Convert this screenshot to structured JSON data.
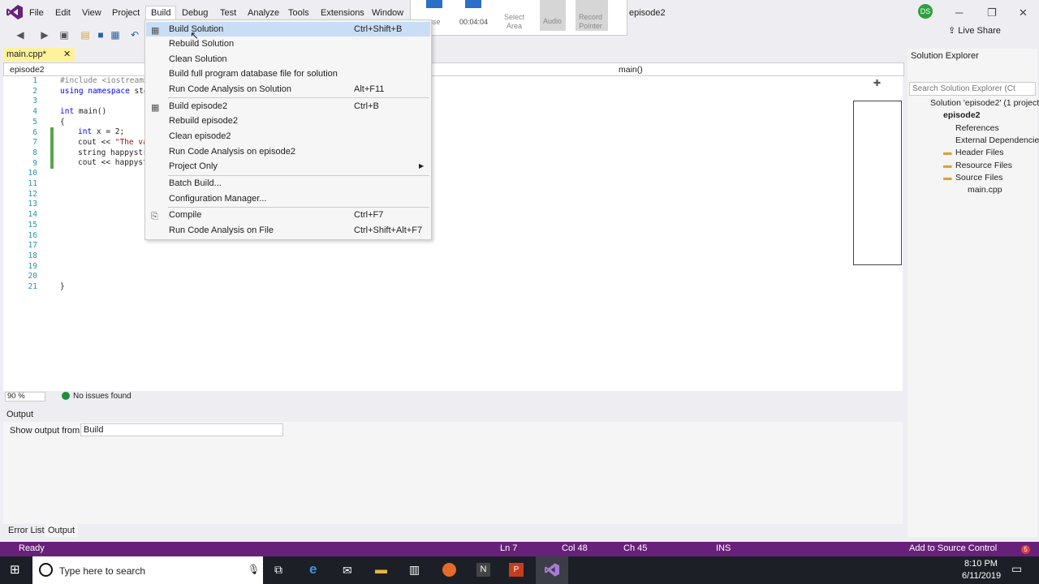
{
  "menu": [
    "File",
    "Edit",
    "View",
    "Project",
    "Build",
    "Debug",
    "Test",
    "Analyze",
    "Tools",
    "Extensions",
    "Window"
  ],
  "window_title": "episode2",
  "user_initials": "DS",
  "live_share": "Live Share",
  "recorder": {
    "timer": "00:04:04",
    "pause": "use",
    "select_area": [
      "Select",
      "Area"
    ],
    "audio": "Audio",
    "record_pointer": [
      "Record",
      "Pointer"
    ]
  },
  "doc_tab": "main.cpp*",
  "nav": {
    "scope": "episode2",
    "member": "main()"
  },
  "code_lines": [
    "1",
    "2",
    "3",
    "4",
    "5",
    "6",
    "7",
    "8",
    "9",
    "10",
    "11",
    "12",
    "13",
    "14",
    "15",
    "16",
    "17",
    "18",
    "19",
    "20",
    "21"
  ],
  "code": {
    "l1": "#include <iostream>",
    "l2_kw": "using namespace",
    "l2_rest": " std",
    "l4_kw": "int",
    "l4_rest": " main()",
    "l5": "{",
    "l6_kw": "int",
    "l6_rest": " x = 2;",
    "l7_a": "cout << ",
    "l7_str": "\"The va",
    "l8_a": "string happystr",
    "l9_a": "cout << happyst",
    "l21": "}"
  },
  "zoom": "90 %",
  "issues": "No issues found",
  "build_menu": [
    {
      "label": "Build Solution",
      "shortcut": "Ctrl+Shift+B",
      "icon": "build-icon"
    },
    {
      "label": "Rebuild Solution",
      "shortcut": ""
    },
    {
      "label": "Clean Solution",
      "shortcut": ""
    },
    {
      "label": "Build full program database file for solution",
      "shortcut": ""
    },
    {
      "label": "Run Code Analysis on Solution",
      "shortcut": "Alt+F11"
    },
    {
      "label": "Build episode2",
      "shortcut": "Ctrl+B",
      "icon": "build-icon"
    },
    {
      "label": "Rebuild episode2",
      "shortcut": ""
    },
    {
      "label": "Clean episode2",
      "shortcut": ""
    },
    {
      "label": "Run Code Analysis on episode2",
      "shortcut": ""
    },
    {
      "label": "Project Only",
      "shortcut": "",
      "submenu": true
    },
    {
      "label": "Batch Build...",
      "shortcut": ""
    },
    {
      "label": "Configuration Manager...",
      "shortcut": ""
    },
    {
      "label": "Compile",
      "shortcut": "Ctrl+F7",
      "icon": "compile-icon"
    },
    {
      "label": "Run Code Analysis on File",
      "shortcut": "Ctrl+Shift+Alt+F7"
    }
  ],
  "output": {
    "title": "Output",
    "show_from_label": "Show output from:",
    "source": "Build"
  },
  "bottom_tabs": [
    "Error List",
    "Output"
  ],
  "solution_explorer": {
    "title": "Solution Explorer",
    "search_placeholder": "Search Solution Explorer (Ct",
    "tree": [
      "Solution 'episode2' (1 project",
      "episode2",
      "References",
      "External Dependencies",
      "Header Files",
      "Resource Files",
      "Source Files",
      "main.cpp"
    ]
  },
  "status": {
    "ready": "Ready",
    "ln": "Ln 7",
    "col": "Col 48",
    "ch": "Ch 45",
    "ins": "INS",
    "source_control": "Add to Source Control",
    "notifications": "5"
  },
  "taskbar": {
    "search": "Type here to search",
    "time": "8:10 PM",
    "date": "6/11/2019"
  },
  "colors": {
    "accent": "#68217a",
    "highlight": "#c9def5",
    "tab_modified": "#fff29d"
  }
}
